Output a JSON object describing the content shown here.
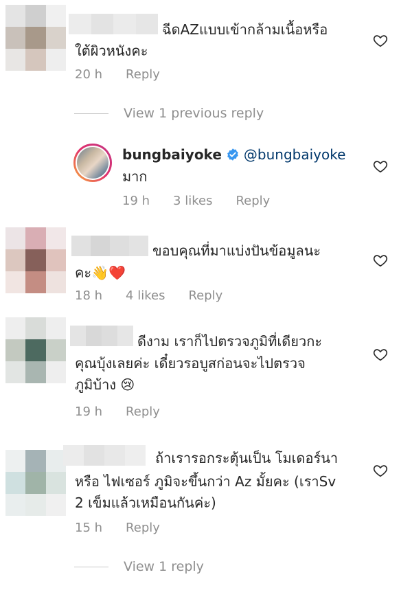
{
  "comments": [
    {
      "text_lines": [
        "ฉีดAZแบบเข้ากล้ามเนื้อหรือ",
        "ใต้ผิวหนังคะ"
      ],
      "time": "20 h",
      "likes": "",
      "reply_label": "Reply",
      "mosaic": [
        "#e4e4e4",
        "#cfcfcf",
        "#f0f0f0",
        "#c9c1ba",
        "#a8998a",
        "#d9d2cb",
        "#e8e6e4",
        "#d5c6bd",
        "#eeeeee"
      ],
      "blur": [
        "#ececec",
        "#e3e3e3",
        "#ebebeb",
        "#e6e6e6"
      ]
    },
    {
      "text_lines": [
        "ขอบคุณที่มาแบ่งปันข้อมูลนะ",
        "คะ👋❤️"
      ],
      "time": "18 h",
      "likes": "4 likes",
      "reply_label": "Reply",
      "mosaic": [
        "#ece4e6",
        "#d9aeb4",
        "#f1e7e8",
        "#dcc7bf",
        "#86605a",
        "#e0c3bd",
        "#f1e5e2",
        "#c48d83",
        "#eee2df"
      ],
      "blur": [
        "#e1e1e1",
        "#d6d6d6",
        "#dedede",
        "#e3e3e3"
      ]
    },
    {
      "text_lines": [
        "ดีงาม  เราก็ไปตรวจภูมิที่เดียวกะ",
        "คุณบุ้งเลยค่ะ เดี๋ยวรอบูสก่อนจะไปตรวจ",
        "ภูมิบ้าง 😢"
      ],
      "time": "19 h",
      "likes": "",
      "reply_label": "Reply",
      "mosaic": [
        "#eeeeee",
        "#d9dcd9",
        "#eeeeee",
        "#c3c9c0",
        "#4d6a60",
        "#c9d0c8",
        "#e2e5e3",
        "#a9b6b1",
        "#eeeeee"
      ],
      "blur": [
        "#e4e4e4",
        "#d8d8d8",
        "#dddddd",
        "#e6e6e6"
      ]
    },
    {
      "text_lines": [
        "ถ้าเรารอกระตุ้นเป็น โมเดอร์นา",
        "หรือ ไฟเซอร์ ภูมิจะขึ้นกว่า Az มั้ยคะ (เราSv",
        "2 เข็มแล้วเหมือนกันค่ะ)"
      ],
      "time": "15 h",
      "likes": "",
      "reply_label": "Reply",
      "mosaic": [
        "#edf0f0",
        "#a5b3b6",
        "#e8eded",
        "#cfe0e0",
        "#a0b4a8",
        "#d9e3df",
        "#e9eeee",
        "#e6ebe9",
        "#f0f0f0"
      ],
      "blur": [
        "#ececec",
        "#e2e2e2",
        "#e8e8e8",
        "#eeeeee"
      ]
    }
  ],
  "view_previous": "View 1 previous reply",
  "view_replies": "View 1 reply",
  "reply": {
    "username": "bungbaiyoke",
    "mention": "@bungbaiyoke",
    "text": "มาก",
    "time": "19 h",
    "likes": "3 likes",
    "reply_label": "Reply"
  },
  "icons": {
    "like": "heart-outline-icon",
    "verified": "verified-badge-icon"
  },
  "colors": {
    "text": "#262626",
    "meta": "#8e8e8e",
    "mention": "#00376b",
    "verified": "#3897f0"
  }
}
